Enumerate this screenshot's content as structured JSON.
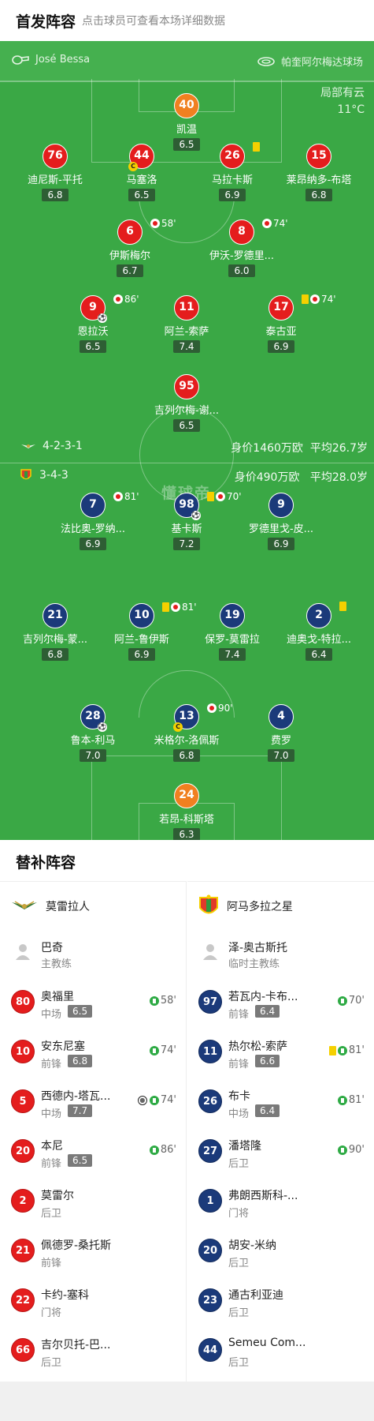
{
  "header": {
    "title": "首发阵容",
    "subtitle": "点击球员可查看本场详细数据"
  },
  "pitch": {
    "coach": "José Bessa",
    "venue": "帕奎阿尔梅达球场",
    "weather": "局部有云",
    "temp": "11°C",
    "watermark": "懂球帝",
    "home_formation": "4-2-3-1",
    "home_value": "身价1460万欧",
    "home_age": "平均26.7岁",
    "away_formation": "3-4-3",
    "away_value": "身价490万欧",
    "away_age": "平均28.0岁",
    "home": [
      {
        "num": "40",
        "name": "凯温",
        "rating": "6.5",
        "gk": true
      },
      {
        "num": "76",
        "name": "迪尼斯-平托",
        "rating": "6.8"
      },
      {
        "num": "44",
        "name": "马塞洛",
        "rating": "6.5",
        "captain": true
      },
      {
        "num": "26",
        "name": "马拉卡斯",
        "rating": "6.9",
        "card": true
      },
      {
        "num": "15",
        "name": "莱昂纳多-布塔",
        "rating": "6.8"
      },
      {
        "num": "6",
        "name": "伊斯梅尔",
        "rating": "6.7",
        "sub": "58'"
      },
      {
        "num": "8",
        "name": "伊沃-罗德里...",
        "rating": "6.0",
        "sub": "74'"
      },
      {
        "num": "9",
        "name": "恩拉沃",
        "rating": "6.5",
        "sub": "86'",
        "ball": true
      },
      {
        "num": "11",
        "name": "阿兰-索萨",
        "rating": "7.4"
      },
      {
        "num": "17",
        "name": "泰古亚",
        "rating": "6.9",
        "card": true,
        "sub": "74'"
      },
      {
        "num": "95",
        "name": "吉列尔梅-谢...",
        "rating": "6.5"
      }
    ],
    "away": [
      {
        "num": "7",
        "name": "法比奥-罗纳...",
        "rating": "6.9",
        "sub": "81'"
      },
      {
        "num": "98",
        "name": "基卡斯",
        "rating": "7.2",
        "card": true,
        "sub": "70'",
        "ball": true
      },
      {
        "num": "9",
        "name": "罗德里戈-皮...",
        "rating": "6.9"
      },
      {
        "num": "21",
        "name": "吉列尔梅-蒙...",
        "rating": "6.8"
      },
      {
        "num": "10",
        "name": "阿兰-鲁伊斯",
        "rating": "6.9",
        "card": true,
        "sub": "81'"
      },
      {
        "num": "19",
        "name": "保罗-莫雷拉",
        "rating": "7.4"
      },
      {
        "num": "2",
        "name": "迪奥戈-特拉...",
        "rating": "6.4",
        "card": true
      },
      {
        "num": "28",
        "name": "鲁本-利马",
        "rating": "7.0",
        "ball": true
      },
      {
        "num": "13",
        "name": "米格尔-洛佩斯",
        "rating": "6.8",
        "captain": true,
        "sub": "90'"
      },
      {
        "num": "4",
        "name": "费罗",
        "rating": "7.0"
      },
      {
        "num": "24",
        "name": "若昂-科斯塔",
        "rating": "6.3",
        "gk": true
      }
    ]
  },
  "subs": {
    "title": "替补阵容",
    "home": {
      "team": "莫雷拉人",
      "coach": "巴奇",
      "coach_role": "主教练",
      "players": [
        {
          "num": "80",
          "name": "奥福里",
          "pos": "中场",
          "rating": "6.5",
          "time": "58'"
        },
        {
          "num": "10",
          "name": "安东尼塞",
          "pos": "前锋",
          "rating": "6.8",
          "time": "74'"
        },
        {
          "num": "5",
          "name": "西德内-塔瓦...",
          "pos": "中场",
          "rating": "7.7",
          "time": "74'",
          "ball": true
        },
        {
          "num": "20",
          "name": "本尼",
          "pos": "前锋",
          "rating": "6.5",
          "time": "86'"
        },
        {
          "num": "2",
          "name": "莫雷尔",
          "pos": "后卫"
        },
        {
          "num": "21",
          "name": "佩德罗-桑托斯",
          "pos": "前锋"
        },
        {
          "num": "22",
          "name": "卡约-塞科",
          "pos": "门将"
        },
        {
          "num": "66",
          "name": "吉尔贝托-巴...",
          "pos": "后卫"
        }
      ]
    },
    "away": {
      "team": "阿马多拉之星",
      "coach": "泽-奥古斯托",
      "coach_role": "临时主教练",
      "players": [
        {
          "num": "97",
          "name": "若瓦内-卡布...",
          "pos": "前锋",
          "rating": "6.4",
          "time": "70'"
        },
        {
          "num": "11",
          "name": "热尔松-索萨",
          "pos": "前锋",
          "rating": "6.6",
          "time": "81'",
          "card": true
        },
        {
          "num": "26",
          "name": "布卡",
          "pos": "中场",
          "rating": "6.4",
          "time": "81'"
        },
        {
          "num": "27",
          "name": "潘塔隆",
          "pos": "后卫",
          "time": "90'"
        },
        {
          "num": "1",
          "name": "弗朗西斯科-...",
          "pos": "门将"
        },
        {
          "num": "20",
          "name": "胡安-米纳",
          "pos": "后卫"
        },
        {
          "num": "23",
          "name": "通古利亚迪",
          "pos": "后卫"
        },
        {
          "num": "44",
          "name": "Semeu Com...",
          "pos": "后卫"
        }
      ]
    }
  }
}
